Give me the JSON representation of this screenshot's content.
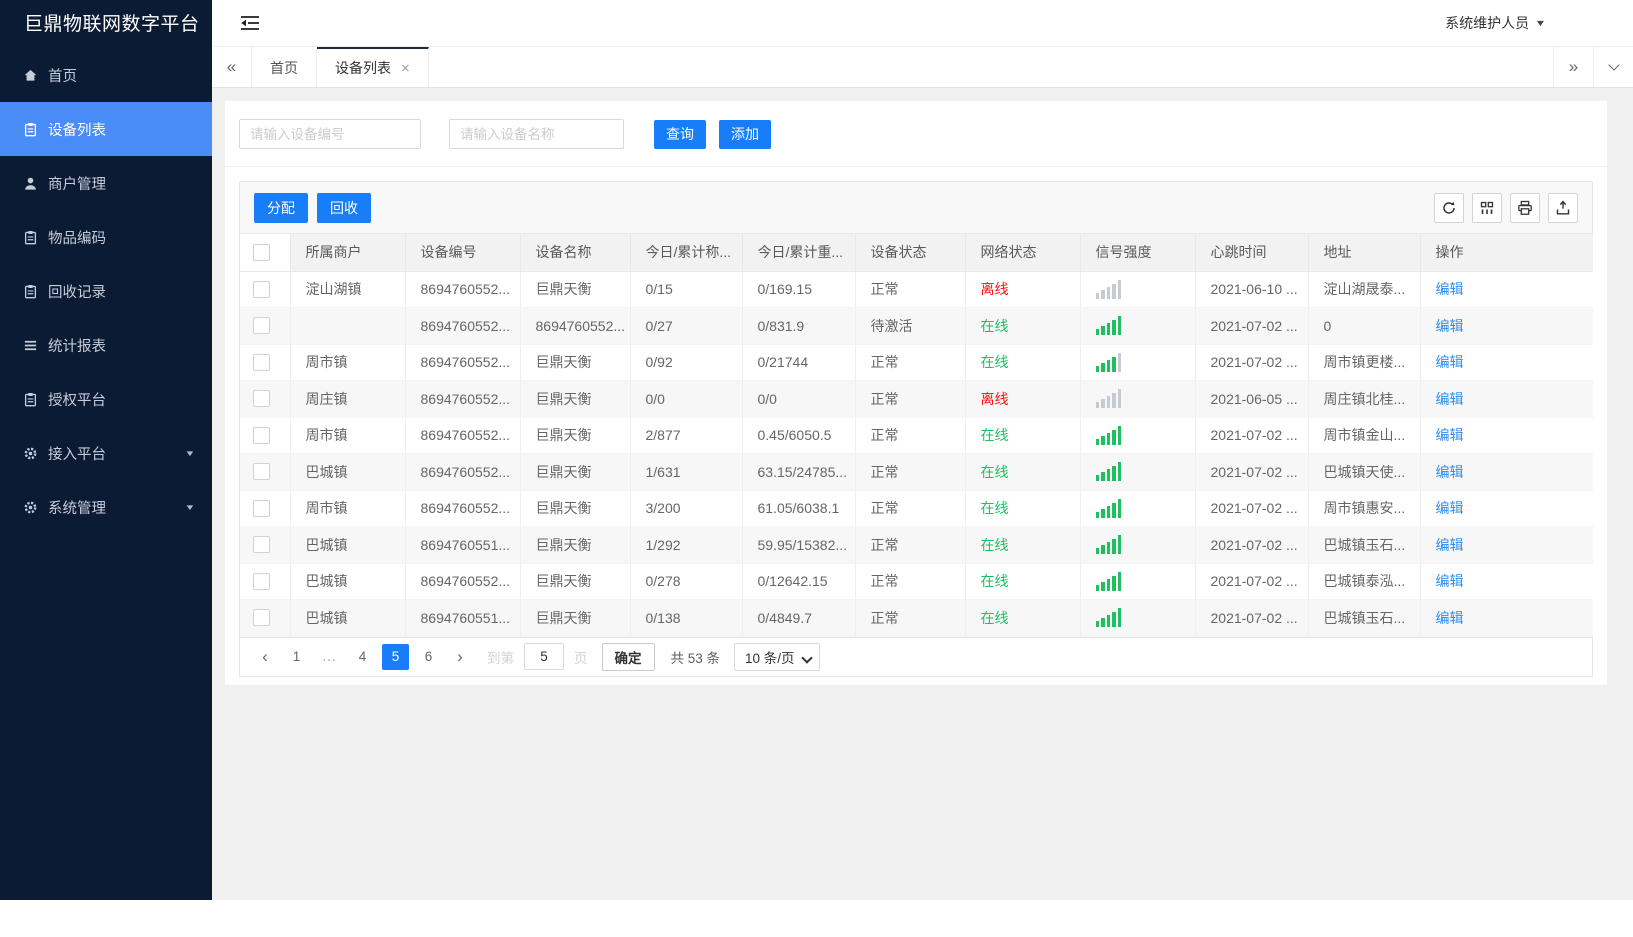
{
  "app": {
    "title": "巨鼎物联网数字平台",
    "user": "系统维护人员"
  },
  "sidebar": {
    "items": [
      {
        "id": "home",
        "icon": "home-icon",
        "label": "首页"
      },
      {
        "id": "device-list",
        "icon": "clipboard-icon",
        "label": "设备列表",
        "active": true
      },
      {
        "id": "merchant-mgmt",
        "icon": "user-icon",
        "label": "商户管理"
      },
      {
        "id": "item-code",
        "icon": "clipboard-icon",
        "label": "物品编码"
      },
      {
        "id": "recycle-record",
        "icon": "clipboard-icon",
        "label": "回收记录"
      },
      {
        "id": "stats-report",
        "icon": "lines-icon",
        "label": "统计报表"
      },
      {
        "id": "auth-platform",
        "icon": "clipboard-icon",
        "label": "授权平台"
      },
      {
        "id": "access-platform",
        "icon": "gear-icon",
        "label": "接入平台",
        "expandable": true
      },
      {
        "id": "system-mgmt",
        "icon": "gear-icon",
        "label": "系统管理",
        "expandable": true
      }
    ]
  },
  "tabbar": {
    "collapse_glyph": "«",
    "expand_glyph": "»",
    "tabs": [
      {
        "id": "home",
        "label": "首页"
      },
      {
        "id": "device-list",
        "label": "设备列表",
        "active": true,
        "closable": true
      }
    ]
  },
  "search": {
    "device_no_placeholder": "请输入设备编号",
    "device_name_placeholder": "请输入设备名称",
    "query_label": "查询",
    "add_label": "添加"
  },
  "toolbar": {
    "assign_label": "分配",
    "recycle_label": "回收",
    "icons": [
      "refresh-icon",
      "columns-icon",
      "print-icon",
      "export-icon"
    ]
  },
  "table": {
    "action_label": "编辑",
    "headers": [
      "所属商户",
      "设备编号",
      "设备名称",
      "今日/累计称...",
      "今日/累计重...",
      "设备状态",
      "网络状态",
      "信号强度",
      "心跳时间",
      "地址",
      "操作"
    ],
    "rows": [
      {
        "merchant": "淀山湖镇",
        "device_no": "8694760552...",
        "device_name": "巨鼎天衡",
        "today_count": "0/15",
        "today_weight": "0/169.15",
        "device_status": "正常",
        "network_status": "离线",
        "online": false,
        "signal": 0,
        "heartbeat": "2021-06-10 ...",
        "address": "淀山湖晟泰..."
      },
      {
        "merchant": "",
        "device_no": "8694760552...",
        "device_name": "8694760552...",
        "today_count": "0/27",
        "today_weight": "0/831.9",
        "device_status": "待激活",
        "network_status": "在线",
        "online": true,
        "signal": 5,
        "heartbeat": "2021-07-02 ...",
        "address": "0"
      },
      {
        "merchant": "周市镇",
        "device_no": "8694760552...",
        "device_name": "巨鼎天衡",
        "today_count": "0/92",
        "today_weight": "0/21744",
        "device_status": "正常",
        "network_status": "在线",
        "online": true,
        "signal": 4,
        "heartbeat": "2021-07-02 ...",
        "address": "周市镇更楼..."
      },
      {
        "merchant": "周庄镇",
        "device_no": "8694760552...",
        "device_name": "巨鼎天衡",
        "today_count": "0/0",
        "today_weight": "0/0",
        "device_status": "正常",
        "network_status": "离线",
        "online": false,
        "signal": 0,
        "heartbeat": "2021-06-05 ...",
        "address": "周庄镇北桂..."
      },
      {
        "merchant": "周市镇",
        "device_no": "8694760552...",
        "device_name": "巨鼎天衡",
        "today_count": "2/877",
        "today_weight": "0.45/6050.5",
        "device_status": "正常",
        "network_status": "在线",
        "online": true,
        "signal": 5,
        "heartbeat": "2021-07-02 ...",
        "address": "周市镇金山..."
      },
      {
        "merchant": "巴城镇",
        "device_no": "8694760552...",
        "device_name": "巨鼎天衡",
        "today_count": "1/631",
        "today_weight": "63.15/24785...",
        "device_status": "正常",
        "network_status": "在线",
        "online": true,
        "signal": 5,
        "heartbeat": "2021-07-02 ...",
        "address": "巴城镇天使..."
      },
      {
        "merchant": "周市镇",
        "device_no": "8694760552...",
        "device_name": "巨鼎天衡",
        "today_count": "3/200",
        "today_weight": "61.05/6038.1",
        "device_status": "正常",
        "network_status": "在线",
        "online": true,
        "signal": 5,
        "heartbeat": "2021-07-02 ...",
        "address": "周市镇惠安..."
      },
      {
        "merchant": "巴城镇",
        "device_no": "8694760551...",
        "device_name": "巨鼎天衡",
        "today_count": "1/292",
        "today_weight": "59.95/15382...",
        "device_status": "正常",
        "network_status": "在线",
        "online": true,
        "signal": 5,
        "heartbeat": "2021-07-02 ...",
        "address": "巴城镇玉石..."
      },
      {
        "merchant": "巴城镇",
        "device_no": "8694760552...",
        "device_name": "巨鼎天衡",
        "today_count": "0/278",
        "today_weight": "0/12642.15",
        "device_status": "正常",
        "network_status": "在线",
        "online": true,
        "signal": 5,
        "heartbeat": "2021-07-02 ...",
        "address": "巴城镇泰泓..."
      },
      {
        "merchant": "巴城镇",
        "device_no": "8694760551...",
        "device_name": "巨鼎天衡",
        "today_count": "0/138",
        "today_weight": "0/4849.7",
        "device_status": "正常",
        "network_status": "在线",
        "online": true,
        "signal": 5,
        "heartbeat": "2021-07-02 ...",
        "address": "巴城镇玉石..."
      }
    ]
  },
  "pagination": {
    "prev_glyph": "‹",
    "next_glyph": "›",
    "pages": [
      {
        "label": "1"
      },
      {
        "label": "...",
        "ellipsis": true
      },
      {
        "label": "4"
      },
      {
        "label": "5",
        "active": true
      },
      {
        "label": "6"
      }
    ],
    "goto_label": "到第",
    "goto_value": "5",
    "unit_label": "页",
    "confirm_label": "确定",
    "total_label": "共 53 条",
    "size_label": "10 条/页"
  },
  "colors": {
    "primary": "#177df8",
    "sidebar_active": "#4a8df8",
    "online": "#1dbf62",
    "offline": "#ff1010",
    "link": "#2d8cf0",
    "signal_on": "#1fc05f",
    "signal_off": "#c6cad1"
  }
}
